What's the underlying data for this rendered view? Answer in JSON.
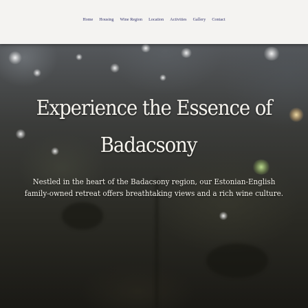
{
  "nav": {
    "items": [
      "Home",
      "Housing",
      "Wine Region",
      "Location",
      "Activities",
      "Gallery",
      "Contact"
    ]
  },
  "hero": {
    "title_line_1": "Experience the Essence of",
    "title_line_2": "Badacsony",
    "description_line_1": "Nestled in the heart of the Badacsony region, our Estonian-English",
    "description_line_2": "family-owned retreat offers breathtaking views and a rich wine culture."
  },
  "colors": {
    "nav_background": "#f4f3f1",
    "nav_text": "#2f2f6a",
    "hero_text": "#f6f4ee"
  }
}
